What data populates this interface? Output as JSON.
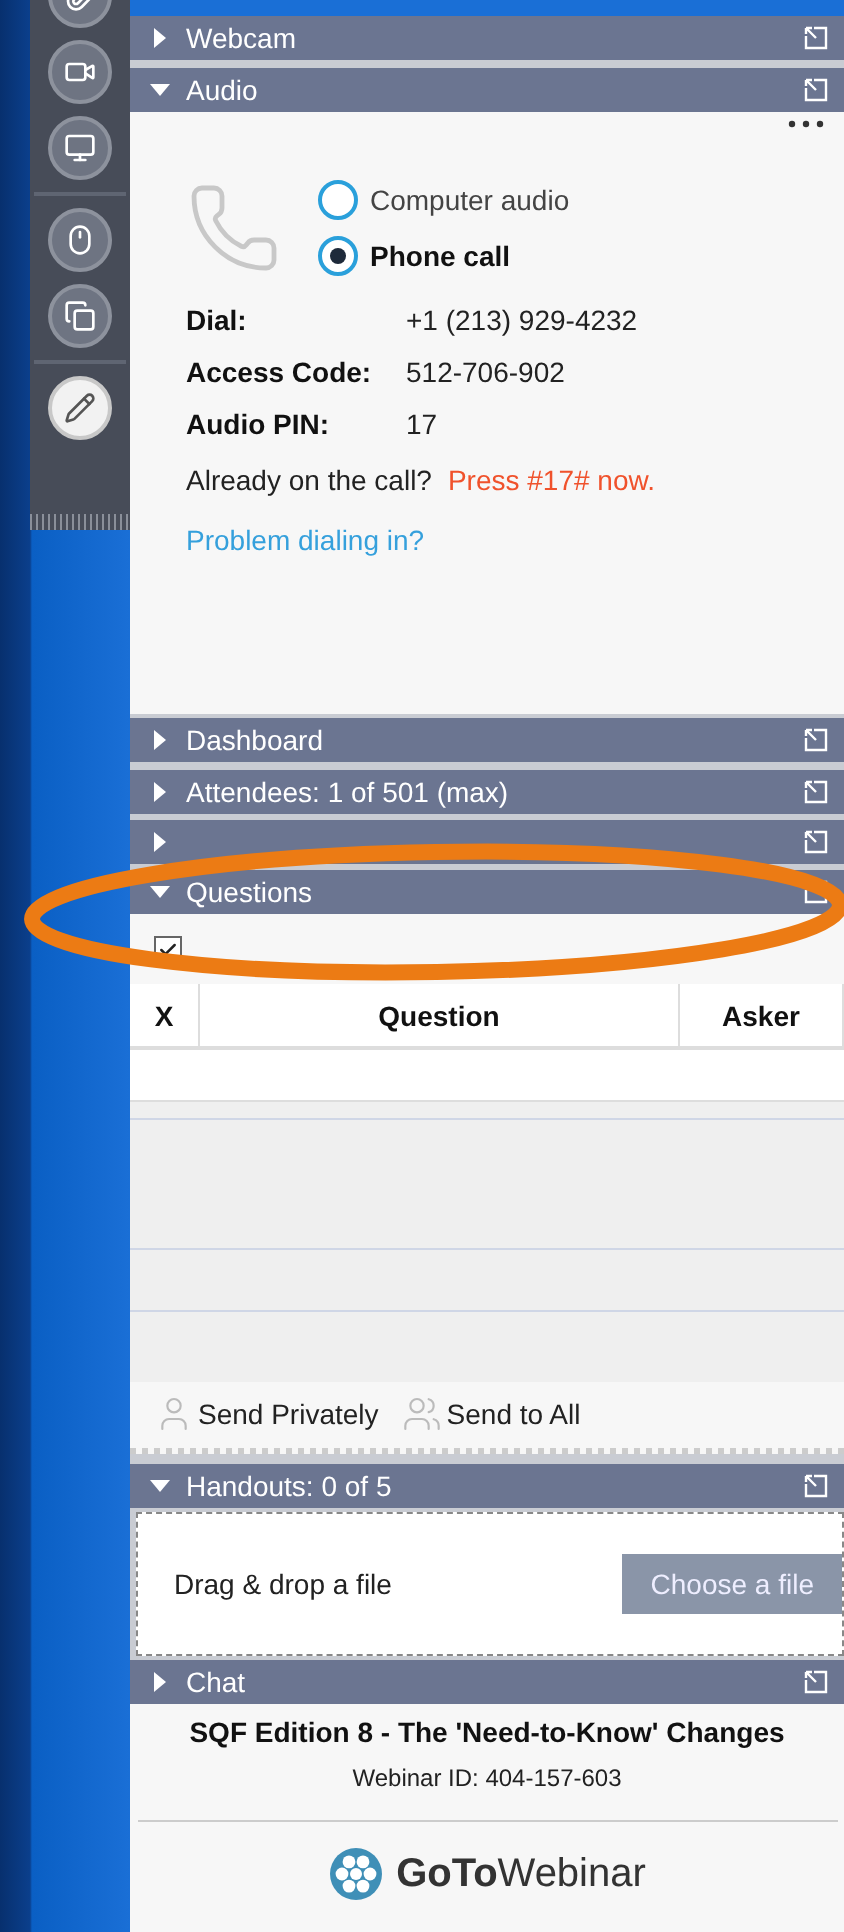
{
  "panels": [
    {
      "title": "Webcam",
      "expanded": false
    },
    {
      "kind": "audio",
      "title": "Audio",
      "expanded": true
    },
    {
      "title": "Dashboard",
      "expanded": false
    },
    {
      "title": "Attendees: 1 of 501 (max)",
      "expanded": false
    },
    {
      "expanded": false
    },
    {
      "kind": "questions",
      "title": "Questions",
      "expanded": true
    },
    {
      "kind": "handouts",
      "title": "Handouts: 0 of 5",
      "expanded": true
    },
    {
      "title": "Chat",
      "expanded": false
    }
  ],
  "audio": {
    "options": [
      {
        "label": "Computer audio",
        "selected": false
      },
      {
        "label": "Phone call",
        "selected": true
      }
    ],
    "details": [
      {
        "label": "Dial:",
        "value": "+1 (213) 929-4232"
      },
      {
        "label": "Access Code:",
        "value": "512-706-902"
      },
      {
        "label": "Audio PIN:",
        "value": "17"
      }
    ],
    "note": "Already on the call?",
    "note_action": "Press #17# now.",
    "link": "Problem dialing in?"
  },
  "questions": {
    "show_answered_checked": true,
    "columns": [
      "X",
      "Question",
      "Asker"
    ],
    "actions": [
      "Send Privately",
      "Send to All"
    ]
  },
  "handouts": {
    "drop_text": "Drag & drop a file",
    "button": "Choose a file"
  },
  "footer": {
    "title": "SQF Edition 8 - The 'Need-to-Know' Changes",
    "webinar_id": "Webinar ID: 404-157-603",
    "brand": "**GoTo**Webinar"
  }
}
